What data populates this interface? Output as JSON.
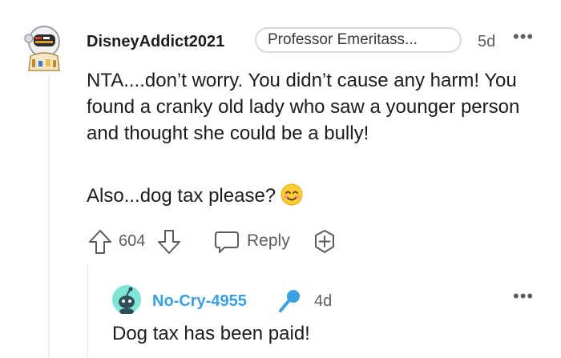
{
  "comment": {
    "username": "DisneyAddict2021",
    "flair": "Professor Emeritass...",
    "age": "5d",
    "more": "•••",
    "body_lines": "NTA....don’t worry. You didn’t cause any harm! You found a cranky old lady who saw a younger person and thought she could be a bully!",
    "body_second": "Also...dog tax please?",
    "emoji": "smiling-face-icon",
    "votes": "604",
    "reply_label": "Reply",
    "icons": {
      "avatar": "astronaut-avatar-icon",
      "upvote": "arrow-up-icon",
      "downvote": "arrow-down-icon",
      "reply": "chat-bubble-icon",
      "award": "award-plus-icon"
    }
  },
  "reply": {
    "username": "No-Cry-4955",
    "age": "4d",
    "more": "•••",
    "body": "Dog tax has been paid!",
    "username_color": "#3aa0e0",
    "icons": {
      "avatar": "snoo-avatar-icon",
      "mic": "microphone-icon"
    }
  }
}
